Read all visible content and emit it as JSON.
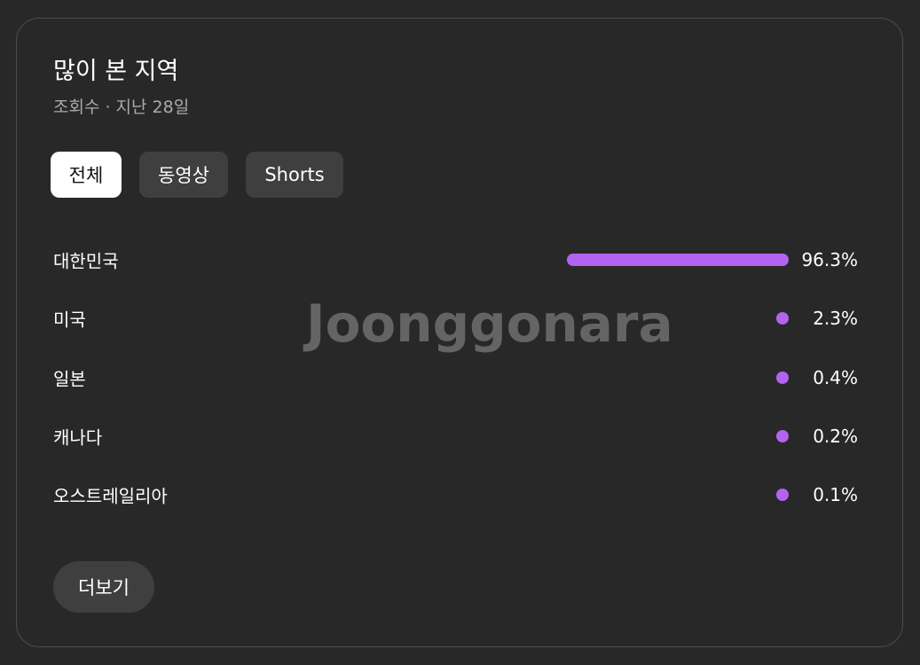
{
  "card": {
    "title": "많이 본 지역",
    "subtitle": "조회수 · 지난 28일"
  },
  "tabs": [
    {
      "label": "전체",
      "active": true
    },
    {
      "label": "동영상",
      "active": false
    },
    {
      "label": "Shorts",
      "active": false
    }
  ],
  "rows": [
    {
      "label": "대한민국",
      "value": "96.3%",
      "percent": 96.3
    },
    {
      "label": "미국",
      "value": "2.3%",
      "percent": 2.3
    },
    {
      "label": "일본",
      "value": "0.4%",
      "percent": 0.4
    },
    {
      "label": "캐나다",
      "value": "0.2%",
      "percent": 0.2
    },
    {
      "label": "오스트레일리아",
      "value": "0.1%",
      "percent": 0.1
    }
  ],
  "watermark": "Joonggonara",
  "more_button": "더보기",
  "colors": {
    "bar": "#b264f0",
    "background": "#282828",
    "chip": "#3f3f3f",
    "chip_active": "#ffffff"
  }
}
